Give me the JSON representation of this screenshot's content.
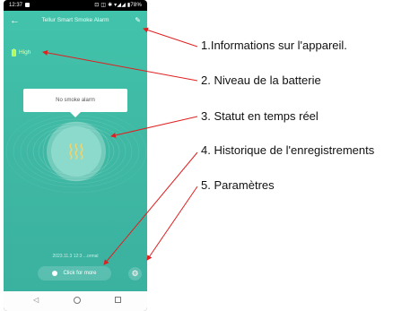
{
  "status_bar": {
    "time": "12:37",
    "icons": "⊡ ◫ ✱ ▾◢◢ ▮78%"
  },
  "app": {
    "title": "Tellur Smart Smoke Alarm",
    "back_icon": "←",
    "edit_icon": "✎",
    "battery": {
      "label": "High",
      "level": 1.0,
      "color": "#b6f75f"
    },
    "status_bubble": "No smoke alarm",
    "record_text": "2023.11.3 12:3  ...ormal",
    "more_button": "Click for more",
    "settings_icon": "gear-icon"
  },
  "annotations": [
    {
      "text": "1.Informations sur l'appareil."
    },
    {
      "text": "2. Niveau de la batterie"
    },
    {
      "text": "3. Statut en temps réel"
    },
    {
      "text": "4. Historique de l'enregistrements"
    },
    {
      "text": "5. Paramètres"
    }
  ],
  "colors": {
    "screen": "#42c3ab",
    "arrow": "#e02020"
  }
}
